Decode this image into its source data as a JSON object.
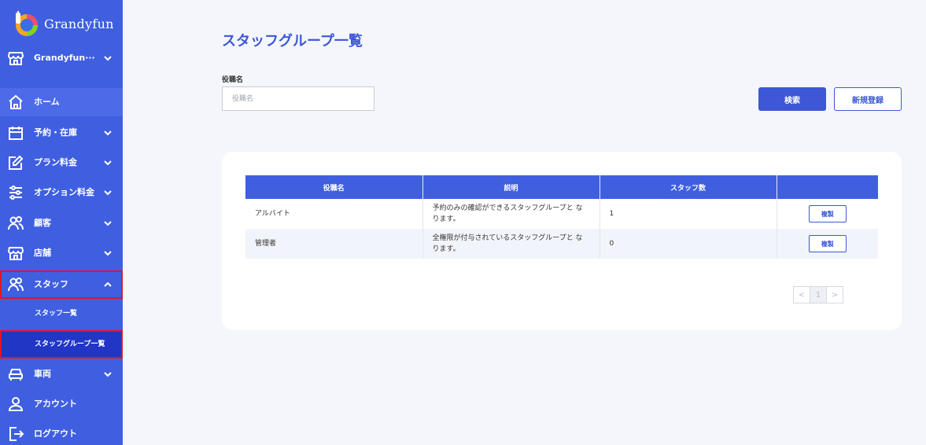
{
  "brand": {
    "name": "Grandyfun"
  },
  "sidebar": {
    "store_selector": {
      "label": "Grandyfun···",
      "icon": "store-icon"
    },
    "items": [
      {
        "label": "ホーム",
        "icon": "home-icon"
      },
      {
        "label": "予約・在庫",
        "icon": "calendar-icon"
      },
      {
        "label": "プラン料金",
        "icon": "edit-icon"
      },
      {
        "label": "オプション料金",
        "icon": "sliders-icon"
      },
      {
        "label": "顧客",
        "icon": "users-icon"
      },
      {
        "label": "店舗",
        "icon": "store-icon"
      },
      {
        "label": "スタッフ",
        "icon": "users-icon"
      },
      {
        "label": "車両",
        "icon": "car-icon"
      },
      {
        "label": "アカウント",
        "icon": "user-icon"
      },
      {
        "label": "ログアウト",
        "icon": "logout-icon"
      }
    ],
    "staff_sub": [
      {
        "label": "スタッフ一覧"
      },
      {
        "label": "スタッフグループ一覧"
      }
    ]
  },
  "main": {
    "title": "スタッフグループ一覧",
    "filter": {
      "label": "役職名",
      "placeholder": "役職名",
      "value": ""
    },
    "search_button": "検索",
    "new_button": "新規登録",
    "table": {
      "headers": [
        "役職名",
        "説明",
        "スタッフ数",
        ""
      ],
      "rows": [
        {
          "name": "アルバイト",
          "description": "予約のみの確認ができるスタッフグループと なります。",
          "count": "1",
          "action": "複製"
        },
        {
          "name": "管理者",
          "description": "全権限が付与されているスタッフグループと なります。",
          "count": "0",
          "action": "複製"
        }
      ]
    },
    "pagination": {
      "prev": "<",
      "current": "1",
      "next": ">"
    }
  },
  "colors": {
    "primary": "#3f5fe0",
    "highlight": "#e8102a",
    "background": "#f4f6fc"
  }
}
